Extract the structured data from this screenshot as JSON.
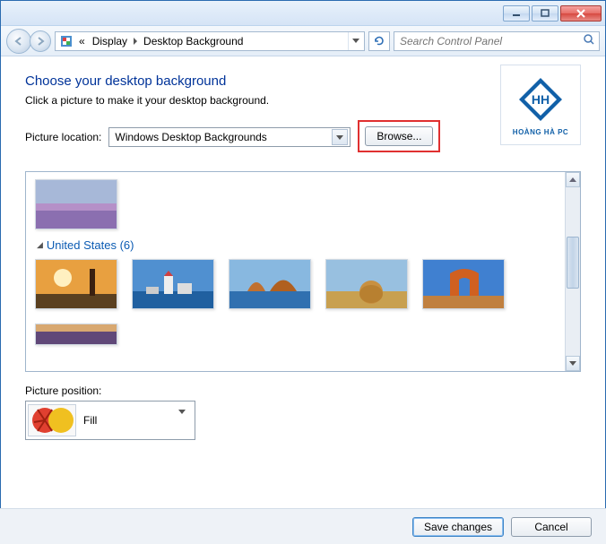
{
  "window": {
    "breadcrumb_prefix": "«",
    "breadcrumb_1": "Display",
    "breadcrumb_2": "Desktop Background",
    "search_placeholder": "Search Control Panel"
  },
  "main": {
    "heading": "Choose your desktop background",
    "subtext": "Click a picture to make it your desktop background.",
    "picture_location_label": "Picture location:",
    "location_value": "Windows Desktop Backgrounds",
    "browse_label": "Browse...",
    "logo_text": "HOÀNG HÀ PC",
    "category_label": "United States (6)",
    "picture_position_label": "Picture position:",
    "position_value": "Fill"
  },
  "footer": {
    "save_label": "Save changes",
    "cancel_label": "Cancel"
  }
}
